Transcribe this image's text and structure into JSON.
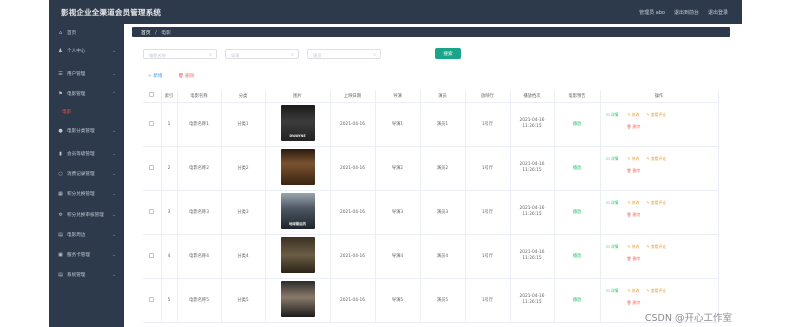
{
  "header": {
    "app_title": "影视企业全渠道会员管理系统",
    "links": [
      "管理员 abo",
      "退出到前台",
      "退出登录"
    ]
  },
  "sidebar": {
    "items": [
      {
        "label": "首页",
        "icon": "home-icon",
        "glyph": "⌂"
      },
      {
        "label": "个人中心",
        "icon": "user-icon",
        "glyph": "♟"
      },
      {
        "label": "用户管理",
        "icon": "users-icon",
        "glyph": "☰"
      },
      {
        "label": "电影管理",
        "icon": "flag-icon",
        "glyph": "⚑"
      },
      {
        "label": "电影分类管理",
        "icon": "location-icon",
        "glyph": "●"
      },
      {
        "label": "会员等级管理",
        "icon": "chart-icon",
        "glyph": "▮"
      },
      {
        "label": "消费记录管理",
        "icon": "circle-icon",
        "glyph": "○"
      },
      {
        "label": "积分兑换管理",
        "icon": "grid-icon",
        "glyph": "▦"
      },
      {
        "label": "积分兑换审核管理",
        "icon": "gear-icon",
        "glyph": "✲"
      },
      {
        "label": "电影周边",
        "icon": "box-icon",
        "glyph": "▤"
      },
      {
        "label": "服务卡管理",
        "icon": "card-icon",
        "glyph": "▣"
      },
      {
        "label": "系统管理",
        "icon": "settings-icon",
        "glyph": "▤"
      }
    ],
    "active_sub": "电影"
  },
  "breadcrumb": {
    "first": "首页",
    "sep": "/",
    "current": "电影"
  },
  "search": {
    "name_placeholder": "电影名称",
    "director_placeholder": "导演",
    "actor_placeholder": "演员",
    "button": "搜索"
  },
  "actions": {
    "add": "+ 新增",
    "delete": "🗑 删除"
  },
  "table": {
    "headers": [
      "",
      "索引",
      "电影名称",
      "分类",
      "图片",
      "上映日期",
      "导演",
      "演员",
      "放映厅",
      "播放档次",
      "电影预告",
      "操作"
    ],
    "rows": [
      {
        "index": "1",
        "name": "电影名称1",
        "category": "分类1",
        "poster_text": "DWAYNE",
        "date": "2021-04-16",
        "director": "导演1",
        "actor": "演员1",
        "hall": "1号厅",
        "schedule": "2021-04-16 11:26:15",
        "trailer": "播放"
      },
      {
        "index": "2",
        "name": "电影名称2",
        "category": "分类2",
        "poster_text": "",
        "date": "2021-04-16",
        "director": "导演2",
        "actor": "演员2",
        "hall": "1号厅",
        "schedule": "2021-04-16 11:26:15",
        "trailer": "播放"
      },
      {
        "index": "3",
        "name": "电影名称3",
        "category": "分类3",
        "poster_text": "地球最后的",
        "date": "2021-04-16",
        "director": "导演3",
        "actor": "演员3",
        "hall": "1号厅",
        "schedule": "2021-04-16 11:26:15",
        "trailer": "播放"
      },
      {
        "index": "4",
        "name": "电影名称4",
        "category": "分类4",
        "poster_text": "",
        "date": "2021-04-16",
        "director": "导演4",
        "actor": "演员4",
        "hall": "1号厅",
        "schedule": "2021-04-16 11:26:15",
        "trailer": "播放"
      },
      {
        "index": "5",
        "name": "电影名称5",
        "category": "分类5",
        "poster_text": "",
        "date": "2021-04-16",
        "director": "导演5",
        "actor": "演员5",
        "hall": "1号厅",
        "schedule": "2021-04-16 11:26:15",
        "trailer": "播放"
      }
    ],
    "ops": {
      "detail": "⊡ 详情",
      "edit": "✎ 修改",
      "review": "✎ 查看评论",
      "delete": "🗑 删除"
    }
  },
  "watermark": "CSDN @开心工作室",
  "colors": {
    "sidebar": "#2d3a4b",
    "primary_button": "#18a58a",
    "add": "#409eff",
    "delete": "#f56c6c",
    "success": "#13ce66",
    "warning": "#e6a23c"
  }
}
